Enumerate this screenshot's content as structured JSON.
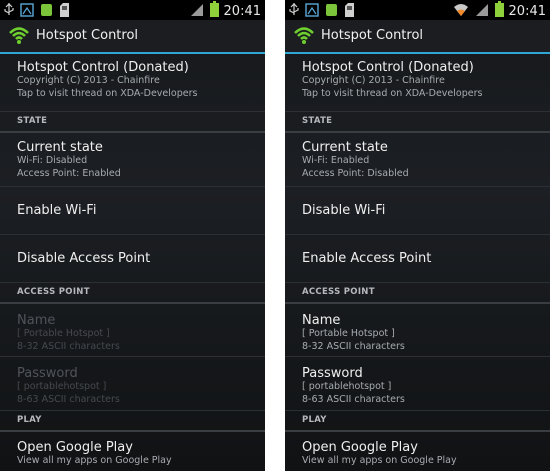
{
  "screens": [
    {
      "status": {
        "time": "20:41"
      },
      "app_title": "Hotspot Control",
      "about": {
        "title": "Hotspot Control (Donated)",
        "line1": "Copyright (C) 2013 - Chainfire",
        "line2": "Tap to visit thread on XDA-Developers"
      },
      "state_header": "STATE",
      "current_state": {
        "title": "Current state",
        "line1": "Wi-Fi: Disabled",
        "line2": "Access Point: Enabled"
      },
      "wifi_toggle": "Enable Wi-Fi",
      "ap_toggle": "Disable Access Point",
      "ap_header": "ACCESS POINT",
      "name": {
        "title": "Name",
        "line1": "[ Portable Hotspot ]",
        "line2": "8-32 ASCII characters"
      },
      "password": {
        "title": "Password",
        "line1": "[ portablehotspot ]",
        "line2": "8-63 ASCII characters"
      },
      "play_header": "PLAY",
      "play": {
        "title": "Open Google Play",
        "line1": "View all my apps on Google Play"
      }
    },
    {
      "status": {
        "time": "20:41"
      },
      "app_title": "Hotspot Control",
      "about": {
        "title": "Hotspot Control (Donated)",
        "line1": "Copyright (C) 2013 - Chainfire",
        "line2": "Tap to visit thread on XDA-Developers"
      },
      "state_header": "STATE",
      "current_state": {
        "title": "Current state",
        "line1": "Wi-Fi: Enabled",
        "line2": "Access Point: Disabled"
      },
      "wifi_toggle": "Disable Wi-Fi",
      "ap_toggle": "Enable Access Point",
      "ap_header": "ACCESS POINT",
      "name": {
        "title": "Name",
        "line1": "[ Portable Hotspot ]",
        "line2": "8-32 ASCII characters"
      },
      "password": {
        "title": "Password",
        "line1": "[ portablehotspot ]",
        "line2": "8-63 ASCII characters"
      },
      "play_header": "PLAY",
      "play": {
        "title": "Open Google Play",
        "line1": "View all my apps on Google Play"
      }
    }
  ],
  "icons": {
    "usb": "usb-icon",
    "screenshot": "screenshot-icon",
    "notification": "notification-icon",
    "sd_card": "sd-card-icon",
    "wifi": "wifi-icon",
    "signal": "signal-icon",
    "battery": "battery-icon",
    "app_logo": "hotspot-logo-icon"
  },
  "colors": {
    "accent": "#2fa6d4",
    "background": "#1c1f23",
    "battery": "#8fd13a",
    "notification": "#7cc43a"
  }
}
